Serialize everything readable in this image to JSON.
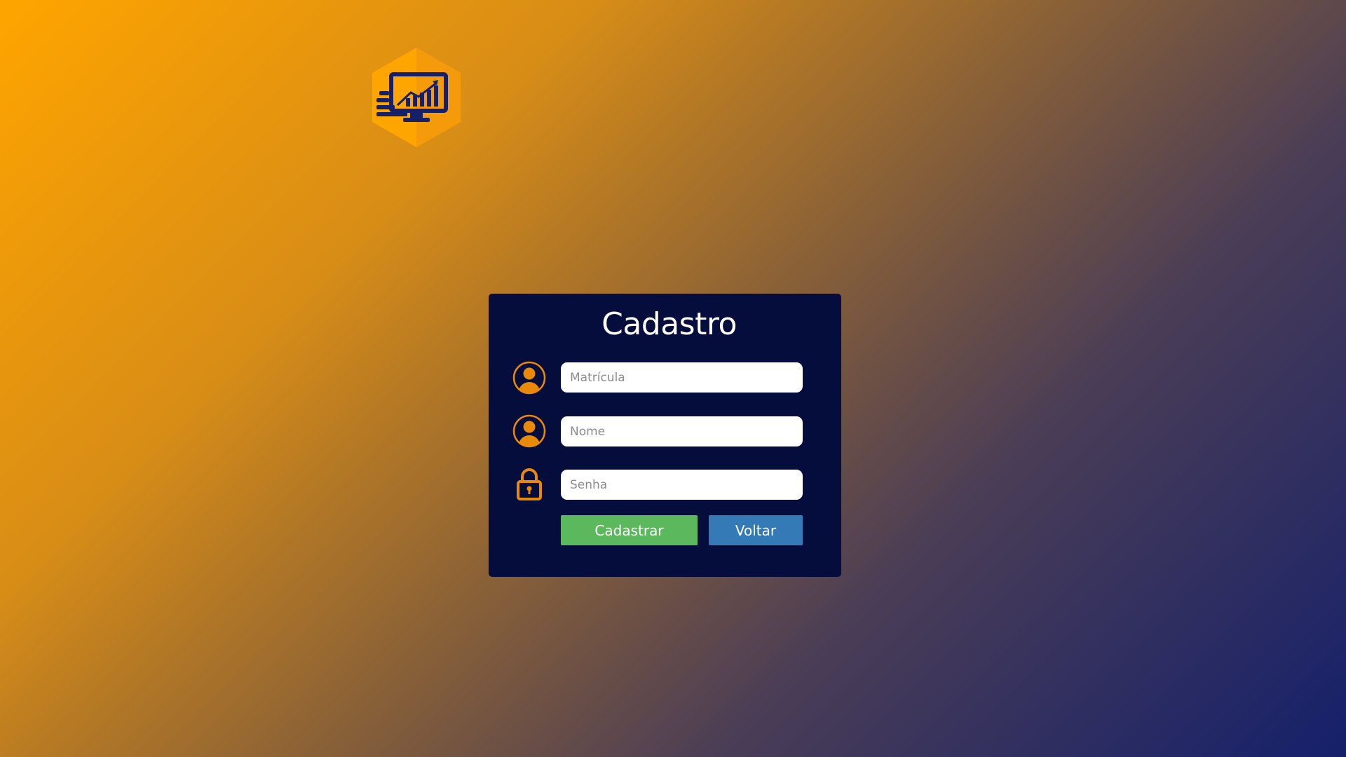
{
  "logo": {
    "icon": "analytics-monitor-icon",
    "colors": {
      "hex": "#ffa500",
      "hex_shade": "#f59a0a",
      "icon": "#15206b"
    }
  },
  "form": {
    "title": "Cadastro",
    "fields": [
      {
        "name": "matricula",
        "placeholder": "Matrícula",
        "value": "",
        "icon": "user-icon"
      },
      {
        "name": "nome",
        "placeholder": "Nome",
        "value": "",
        "icon": "user-icon"
      },
      {
        "name": "senha",
        "placeholder": "Senha",
        "value": "",
        "icon": "lock-icon"
      }
    ],
    "buttons": {
      "primary_label": "Cadastrar",
      "secondary_label": "Voltar"
    }
  },
  "colors": {
    "card_bg": "#040d3b",
    "accent": "#e8890a",
    "primary_button": "#5cb85c",
    "secondary_button": "#337ab7"
  }
}
